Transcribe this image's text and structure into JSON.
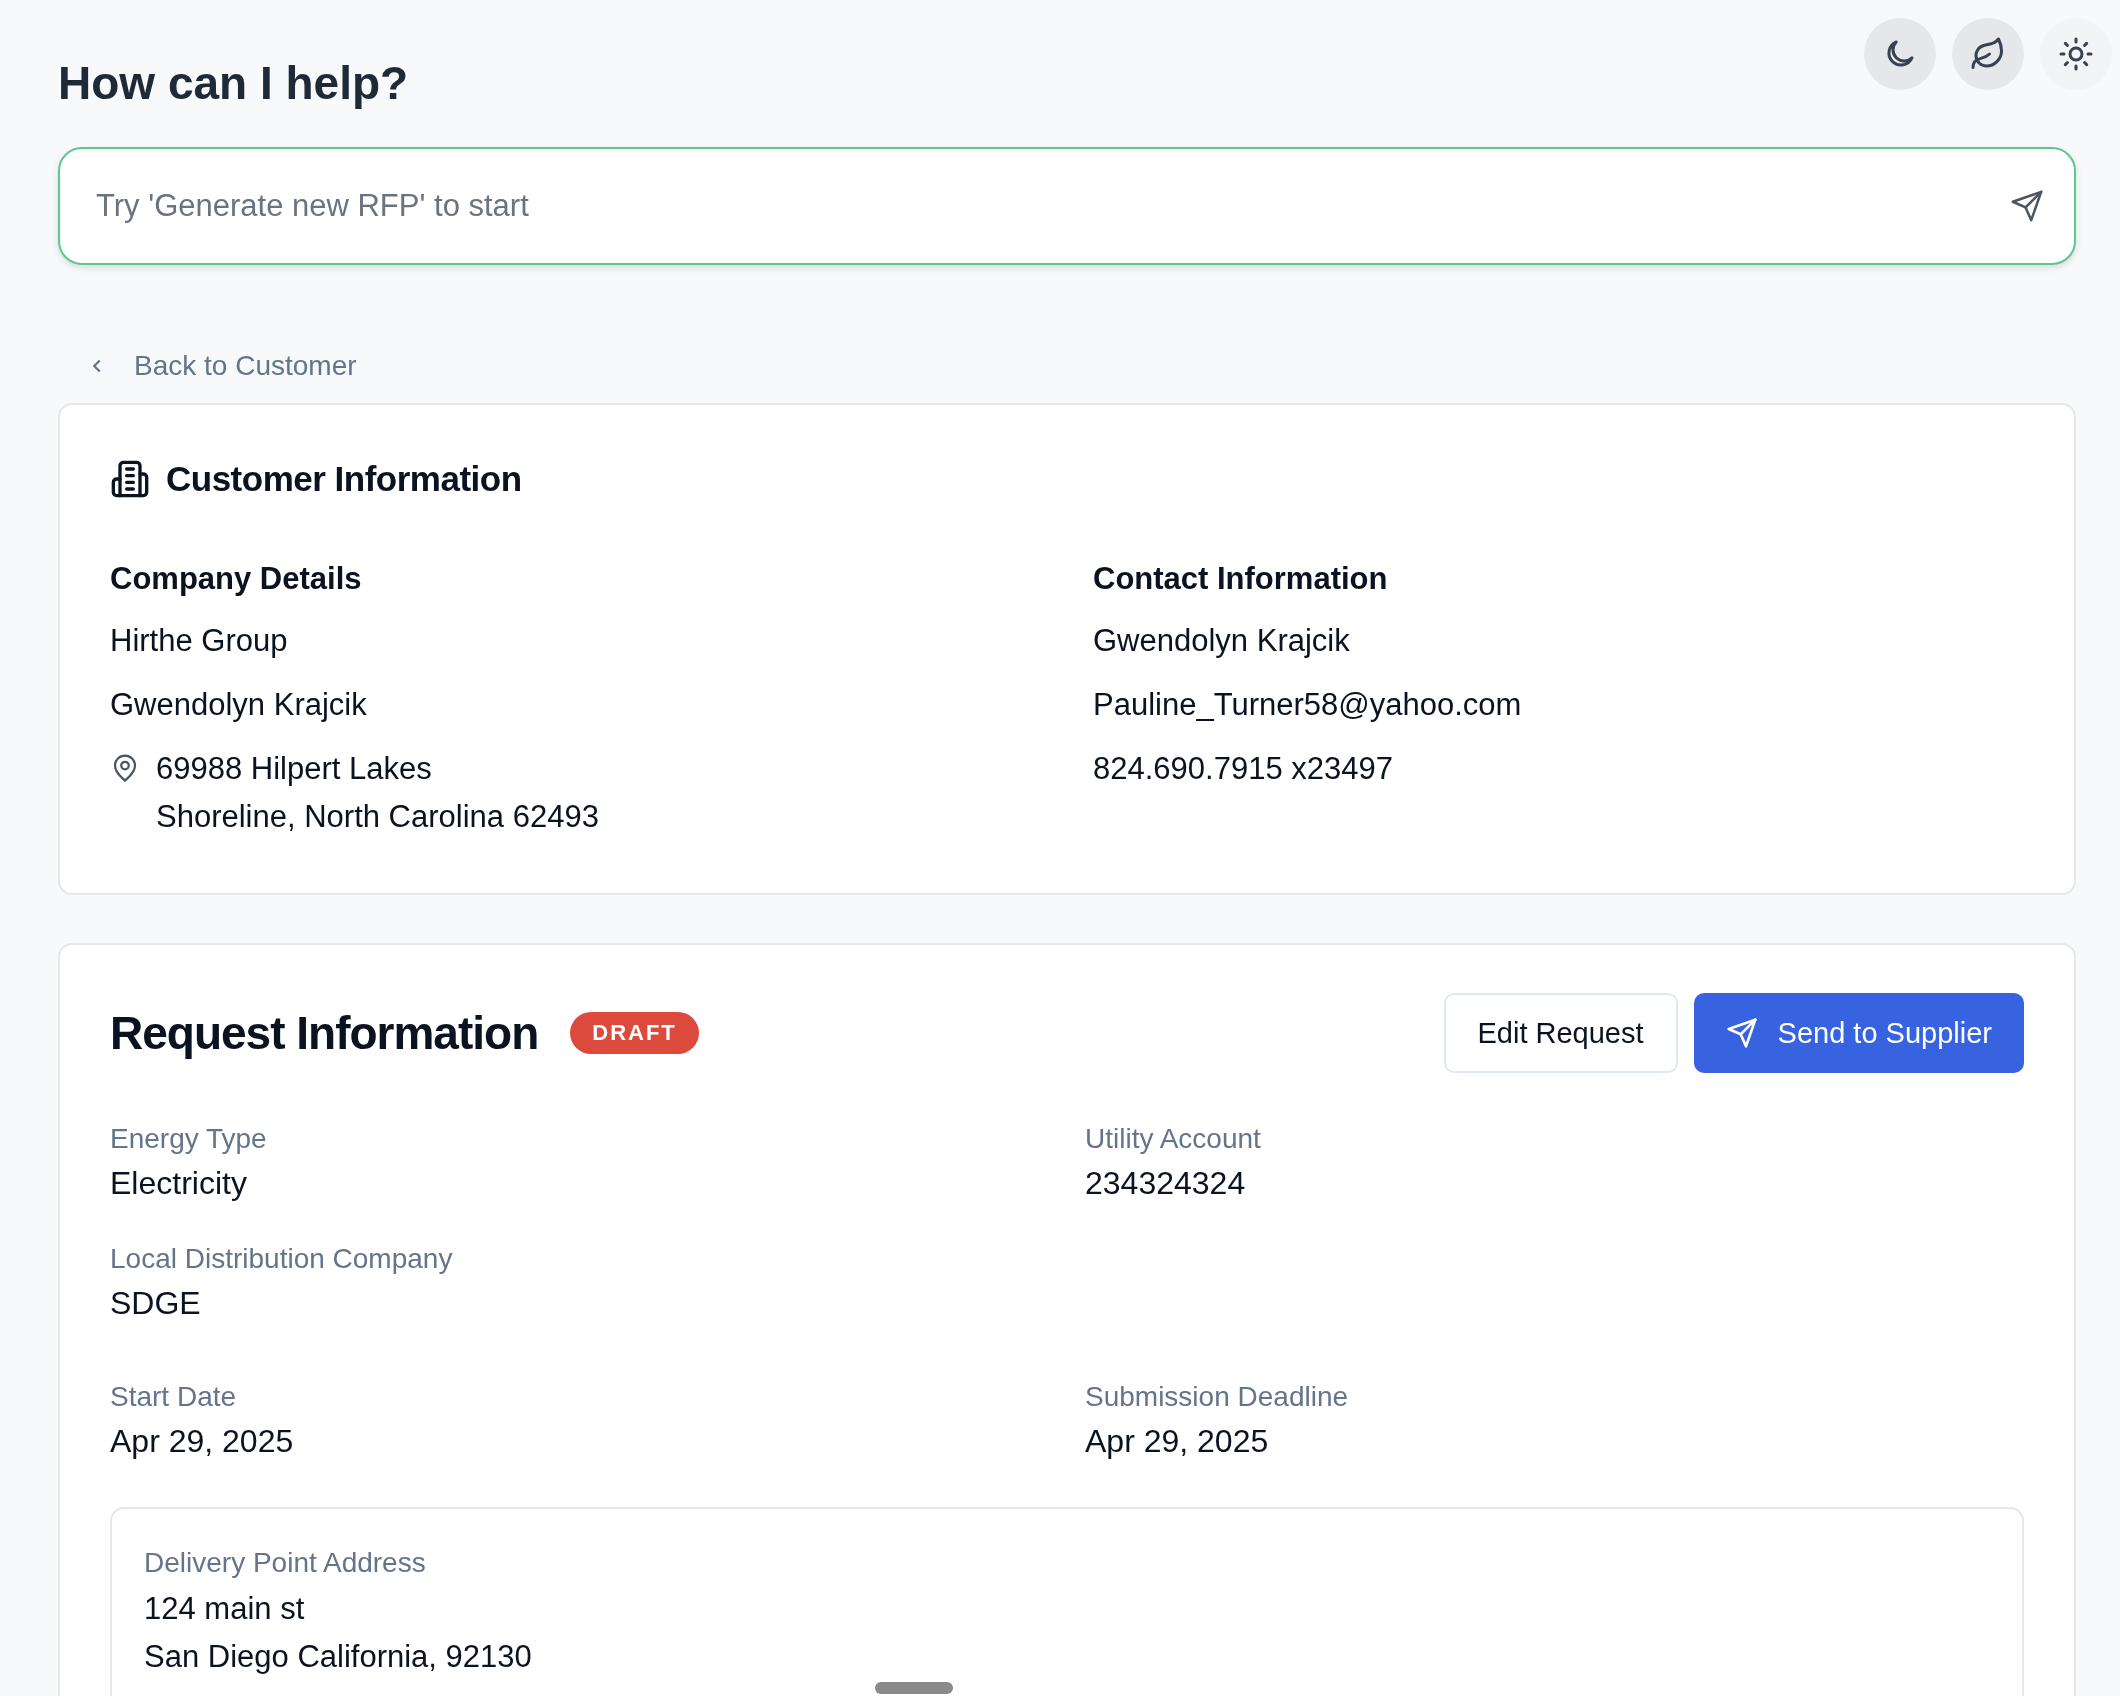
{
  "header": {
    "title": "How can I help?"
  },
  "theme_buttons": [
    {
      "kind": "moon",
      "active": true
    },
    {
      "kind": "leaf",
      "active": true
    },
    {
      "kind": "sun",
      "active": false
    }
  ],
  "prompt": {
    "placeholder": "Try 'Generate new RFP' to start"
  },
  "back_link": "Back to Customer",
  "customer": {
    "title": "Customer Information",
    "company": {
      "heading": "Company Details",
      "lines": [
        "Hirthe Group",
        "Gwendolyn Krajcik"
      ],
      "address": [
        "69988 Hilpert Lakes",
        "Shoreline, North Carolina 62493"
      ]
    },
    "contact": {
      "heading": "Contact Information",
      "lines": [
        "Gwendolyn Krajcik",
        "Pauline_Turner58@yahoo.com",
        "824.690.7915 x23497"
      ]
    }
  },
  "request": {
    "title": "Request Information",
    "status": "DRAFT",
    "buttons": [
      {
        "label": "Edit Request",
        "kind": "secondary"
      },
      {
        "label": "Send to Supplier",
        "kind": "primary"
      }
    ],
    "fields": [
      [
        {
          "label": "Energy Type",
          "value": "Electricity"
        },
        {
          "label": "Utility Account",
          "value": "234324324"
        }
      ],
      [
        {
          "label": "Local Distribution Company",
          "value": "SDGE"
        }
      ],
      [
        {
          "label": "Start Date",
          "value": "Apr 29, 2025"
        },
        {
          "label": "Submission Deadline",
          "value": "Apr 29, 2025"
        }
      ]
    ],
    "delivery": {
      "label": "Delivery Point Address",
      "lines": [
        "124 main st",
        "San Diego California, 92130"
      ]
    }
  }
}
